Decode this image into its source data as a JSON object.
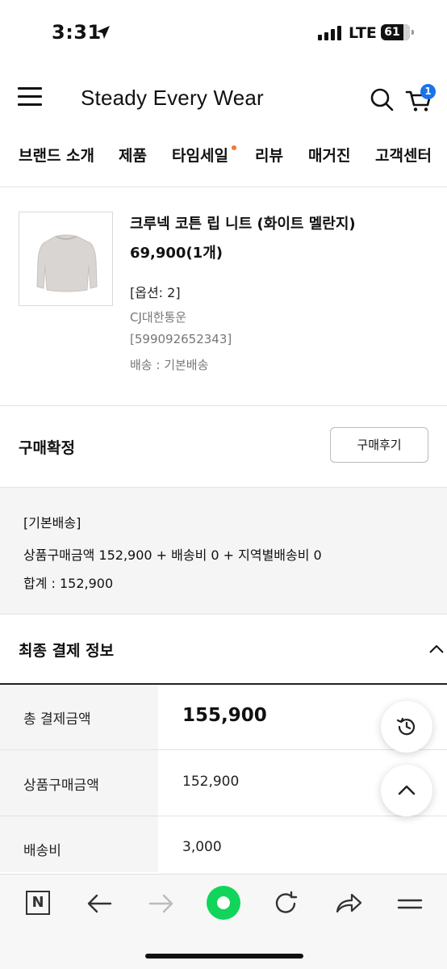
{
  "status_bar": {
    "time": "3:31",
    "network": "LTE",
    "battery": "61"
  },
  "header": {
    "title": "Steady Every Wear",
    "cart_count": "1"
  },
  "nav": {
    "items": [
      "브랜드 소개",
      "제품",
      "타임세일",
      "리뷰",
      "매거진",
      "고객센터"
    ]
  },
  "product": {
    "name": "크루넥 코튼 립 니트 (화이트 멜란지)",
    "price": "69,900(1개)",
    "option": "[옵션: 2]",
    "courier": "CJ대한통운",
    "tracking": "[599092652343]",
    "delivery": "배송 : 기본배송"
  },
  "confirm": {
    "label": "구매확정",
    "review_button": "구매후기"
  },
  "shipping": {
    "type": "[기본배송]",
    "breakdown": "상품구매금액 152,900 + 배송비 0 + 지역별배송비 0",
    "total": "합계 : 152,900"
  },
  "final_payment": {
    "title": "최종 결제 정보",
    "rows": [
      {
        "label": "총 결제금액",
        "value": "155,900"
      },
      {
        "label": "상품구매금액",
        "value": "152,900"
      },
      {
        "label": "배송비",
        "value": "3,000"
      }
    ]
  },
  "icons": {
    "menu": "hamburger-icon",
    "search": "search-icon",
    "cart": "cart-icon",
    "history": "history-icon",
    "scroll_top": "chevron-up-icon"
  },
  "colors": {
    "badge": "#1a73e8",
    "nav_dot": "#f07b2c",
    "browser_green": "#10d55a"
  }
}
